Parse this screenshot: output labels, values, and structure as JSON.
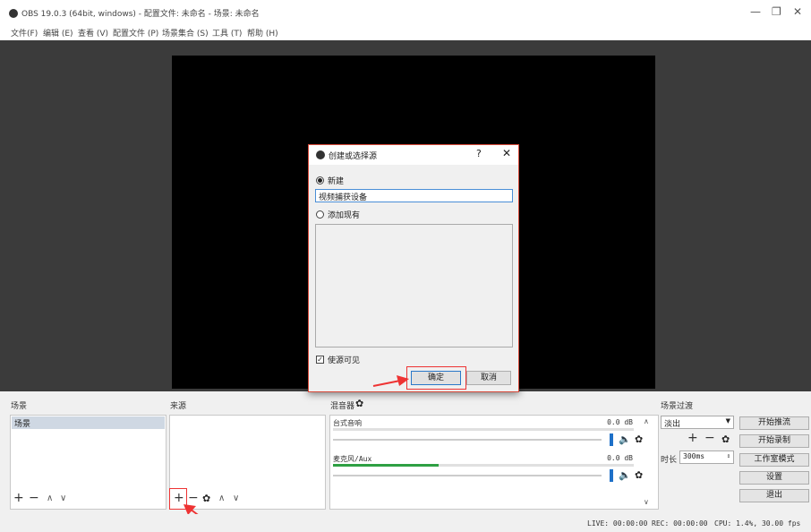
{
  "window": {
    "title": "OBS 19.0.3 (64bit, windows) - 配置文件: 未命名 - 场景: 未命名",
    "minimize": "—",
    "restore": "❐",
    "close": "✕"
  },
  "menu": [
    "文件(F)",
    "编辑 (E)",
    "查看 (V)",
    "配置文件 (P)",
    "场景集合 (S)",
    "工具 (T)",
    "帮助 (H)"
  ],
  "dialog": {
    "title": "创建或选择源",
    "help": "?",
    "close": "✕",
    "new_label": "新建",
    "name_value": "视频捕获设备",
    "existing_label": "添加现有",
    "visible_label": "使源可见",
    "ok_label": "确定",
    "cancel_label": "取消"
  },
  "docks": {
    "scenes": {
      "title": "场景",
      "items": [
        "场景"
      ]
    },
    "sources": {
      "title": "来源"
    },
    "mixer": {
      "title": "混音器",
      "channels": [
        {
          "name": "台式音响",
          "db": "0.0 dB",
          "level": 0.0
        },
        {
          "name": "麦克风/Aux",
          "db": "0.0 dB",
          "level": 0.35
        }
      ]
    },
    "transitions": {
      "title": "场景过渡",
      "selected": "淡出",
      "duration_label": "时长",
      "duration_value": "300ms"
    },
    "controls": [
      "开始推流",
      "开始录制",
      "工作室模式",
      "设置",
      "退出"
    ]
  },
  "icons": {
    "add": "+",
    "remove": "−",
    "up": "∧",
    "down": "∨",
    "gear": "✿",
    "speaker": "🔈"
  },
  "status": {
    "live": "LIVE: 00:00:00",
    "rec": "REC: 00:00:00",
    "cpu": "CPU: 1.4%, 30.00 fps"
  },
  "colors": {
    "highlight": "#e33333",
    "accent": "#1e70c8",
    "meter": "#2ea043"
  }
}
